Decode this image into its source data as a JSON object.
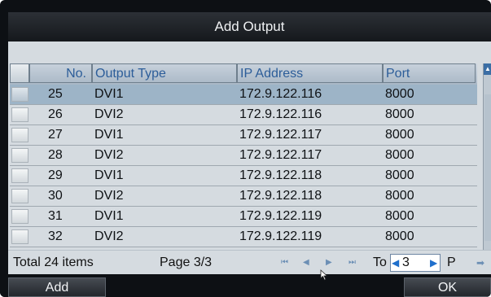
{
  "dialog": {
    "title": "Add Output"
  },
  "table": {
    "columns": [
      "No.",
      "Output Type",
      "IP Address",
      "Port"
    ],
    "rows": [
      {
        "no": "25",
        "type": "DVI1",
        "ip": "172.9.122.116",
        "port": "8000",
        "selected": true
      },
      {
        "no": "26",
        "type": "DVI2",
        "ip": "172.9.122.116",
        "port": "8000"
      },
      {
        "no": "27",
        "type": "DVI1",
        "ip": "172.9.122.117",
        "port": "8000"
      },
      {
        "no": "28",
        "type": "DVI2",
        "ip": "172.9.122.117",
        "port": "8000"
      },
      {
        "no": "29",
        "type": "DVI1",
        "ip": "172.9.122.118",
        "port": "8000"
      },
      {
        "no": "30",
        "type": "DVI2",
        "ip": "172.9.122.118",
        "port": "8000"
      },
      {
        "no": "31",
        "type": "DVI1",
        "ip": "172.9.122.119",
        "port": "8000"
      },
      {
        "no": "32",
        "type": "DVI2",
        "ip": "172.9.122.119",
        "port": "8000"
      }
    ]
  },
  "footer": {
    "total": "Total 24 items",
    "page": "Page 3/3",
    "to_label": "To",
    "page_input_value": "3",
    "p_label": "P"
  },
  "buttons": {
    "add": "Add",
    "ok": "OK"
  },
  "colors": {
    "selected_row": "#9db4c7",
    "header_text": "#2c5d99",
    "background": "#0d1014"
  }
}
